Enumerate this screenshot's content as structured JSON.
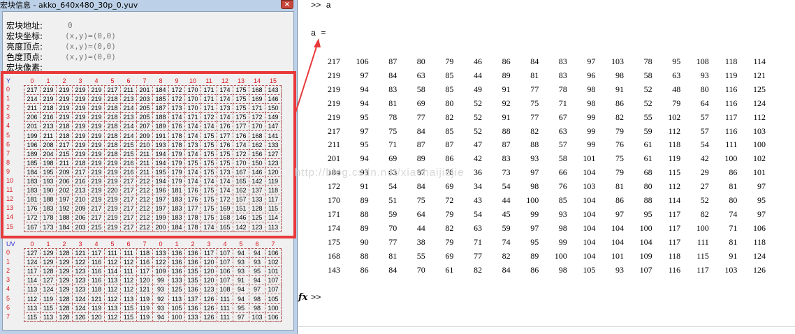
{
  "window": {
    "title": "宏块信息 - akko_640x480_30p_0.yuv",
    "close_label": "×"
  },
  "info": {
    "address_label": "宏块地址:",
    "address_value": "0",
    "coord_label": "宏块坐标:",
    "coord_value": "(x,y)=(0,0)",
    "luma_label": "亮度顶点:",
    "luma_value": "(x,y)=(0,0)",
    "chroma_label": "色度顶点:",
    "chroma_value": "(x,y)=(0,0)",
    "pixels_label": "宏块像素:"
  },
  "y_grid": {
    "corner": "Y",
    "columns": [
      "0",
      "1",
      "2",
      "3",
      "4",
      "5",
      "6",
      "7",
      "8",
      "9",
      "10",
      "11",
      "12",
      "13",
      "14",
      "15"
    ],
    "rows": [
      "0",
      "1",
      "2",
      "3",
      "4",
      "5",
      "6",
      "7",
      "8",
      "9",
      "10",
      "11",
      "12",
      "13",
      "14",
      "15"
    ],
    "values": [
      [
        217,
        219,
        219,
        219,
        219,
        217,
        211,
        201,
        184,
        172,
        170,
        171,
        174,
        175,
        168,
        143
      ],
      [
        214,
        219,
        219,
        219,
        219,
        218,
        213,
        203,
        185,
        172,
        170,
        171,
        174,
        175,
        169,
        146
      ],
      [
        211,
        218,
        219,
        219,
        219,
        218,
        214,
        205,
        187,
        173,
        170,
        171,
        173,
        175,
        171,
        150
      ],
      [
        206,
        216,
        219,
        219,
        219,
        218,
        213,
        205,
        188,
        174,
        171,
        172,
        174,
        175,
        172,
        149
      ],
      [
        201,
        213,
        218,
        219,
        219,
        218,
        214,
        207,
        189,
        176,
        174,
        174,
        176,
        177,
        170,
        147
      ],
      [
        199,
        211,
        218,
        219,
        219,
        218,
        214,
        209,
        191,
        178,
        174,
        175,
        177,
        176,
        168,
        141
      ],
      [
        196,
        208,
        217,
        219,
        219,
        218,
        215,
        210,
        193,
        178,
        173,
        175,
        176,
        174,
        162,
        133
      ],
      [
        189,
        204,
        215,
        219,
        219,
        218,
        215,
        211,
        194,
        179,
        174,
        175,
        175,
        172,
        156,
        127
      ],
      [
        185,
        198,
        211,
        218,
        219,
        219,
        216,
        211,
        194,
        179,
        175,
        175,
        175,
        170,
        150,
        123
      ],
      [
        184,
        195,
        209,
        217,
        219,
        219,
        216,
        211,
        195,
        179,
        174,
        175,
        173,
        167,
        146,
        120
      ],
      [
        183,
        193,
        206,
        216,
        219,
        219,
        217,
        212,
        194,
        179,
        174,
        174,
        174,
        165,
        142,
        119
      ],
      [
        183,
        190,
        202,
        213,
        219,
        220,
        217,
        212,
        196,
        181,
        176,
        175,
        174,
        162,
        137,
        118
      ],
      [
        181,
        188,
        197,
        210,
        219,
        219,
        217,
        212,
        197,
        183,
        176,
        175,
        172,
        157,
        133,
        117
      ],
      [
        176,
        183,
        192,
        209,
        217,
        219,
        217,
        212,
        197,
        183,
        177,
        175,
        169,
        151,
        128,
        115
      ],
      [
        172,
        178,
        188,
        206,
        217,
        219,
        217,
        212,
        199,
        183,
        178,
        175,
        168,
        146,
        125,
        114
      ],
      [
        167,
        173,
        184,
        203,
        215,
        219,
        217,
        212,
        200,
        184,
        178,
        174,
        165,
        142,
        123,
        113
      ]
    ]
  },
  "uv_grid": {
    "corner": "UV",
    "columns": [
      "0",
      "1",
      "2",
      "3",
      "4",
      "5",
      "6",
      "7",
      "0",
      "1",
      "2",
      "3",
      "4",
      "5",
      "6",
      "7"
    ],
    "rows": [
      "0",
      "1",
      "2",
      "3",
      "4",
      "5",
      "6",
      "7"
    ],
    "values": [
      [
        127,
        129,
        128,
        121,
        117,
        111,
        111,
        118,
        133,
        136,
        136,
        117,
        107,
        94,
        94,
        106
      ],
      [
        124,
        129,
        129,
        122,
        116,
        112,
        112,
        116,
        122,
        136,
        136,
        120,
        107,
        93,
        93,
        102
      ],
      [
        117,
        128,
        129,
        123,
        116,
        114,
        111,
        117,
        109,
        136,
        135,
        120,
        106,
        93,
        95,
        101
      ],
      [
        114,
        127,
        129,
        123,
        116,
        113,
        112,
        120,
        99,
        133,
        135,
        120,
        107,
        91,
        94,
        107
      ],
      [
        113,
        124,
        129,
        123,
        118,
        112,
        112,
        121,
        93,
        125,
        136,
        123,
        108,
        94,
        97,
        107
      ],
      [
        112,
        119,
        128,
        124,
        121,
        112,
        113,
        119,
        92,
        113,
        137,
        126,
        111,
        94,
        98,
        105
      ],
      [
        113,
        115,
        128,
        124,
        119,
        113,
        115,
        119,
        93,
        105,
        136,
        126,
        111,
        95,
        98,
        100
      ],
      [
        115,
        113,
        128,
        126,
        120,
        112,
        115,
        119,
        94,
        100,
        133,
        126,
        111,
        97,
        103,
        106
      ]
    ]
  },
  "console": {
    "prompt_top": ">> a",
    "var_line": "a =",
    "prompt_bottom": ">>",
    "fx_label": "fx",
    "watermark": "http://blog.csdn.net/xiaohaijiejie",
    "matrix": [
      [
        217,
        106,
        87,
        80,
        79,
        46,
        86,
        84,
        83,
        97,
        103,
        78,
        95,
        108,
        118,
        114
      ],
      [
        219,
        97,
        84,
        63,
        85,
        44,
        89,
        81,
        83,
        96,
        98,
        58,
        63,
        93,
        119,
        121
      ],
      [
        219,
        94,
        83,
        58,
        85,
        49,
        91,
        77,
        78,
        98,
        91,
        52,
        48,
        80,
        116,
        125
      ],
      [
        219,
        94,
        81,
        69,
        80,
        52,
        92,
        75,
        71,
        98,
        86,
        52,
        79,
        64,
        116,
        124
      ],
      [
        219,
        95,
        78,
        77,
        82,
        52,
        91,
        77,
        67,
        99,
        82,
        55,
        102,
        57,
        117,
        112
      ],
      [
        217,
        97,
        75,
        84,
        85,
        52,
        88,
        82,
        63,
        99,
        79,
        59,
        112,
        57,
        116,
        103
      ],
      [
        211,
        95,
        71,
        87,
        87,
        47,
        87,
        88,
        57,
        99,
        76,
        61,
        118,
        54,
        111,
        100
      ],
      [
        201,
        94,
        69,
        89,
        86,
        42,
        83,
        93,
        58,
        101,
        75,
        61,
        119,
        42,
        100,
        102
      ],
      [
        184,
        93,
        63,
        87,
        78,
        36,
        73,
        97,
        66,
        104,
        79,
        68,
        115,
        29,
        86,
        101
      ],
      [
        172,
        91,
        54,
        84,
        69,
        34,
        54,
        98,
        76,
        103,
        81,
        80,
        112,
        27,
        81,
        97
      ],
      [
        170,
        89,
        51,
        75,
        72,
        43,
        44,
        100,
        85,
        104,
        86,
        88,
        114,
        52,
        80,
        95
      ],
      [
        171,
        88,
        59,
        64,
        79,
        54,
        45,
        99,
        93,
        104,
        97,
        95,
        117,
        82,
        74,
        97
      ],
      [
        174,
        89,
        70,
        44,
        82,
        63,
        59,
        97,
        98,
        104,
        104,
        100,
        117,
        100,
        71,
        106
      ],
      [
        175,
        90,
        77,
        38,
        79,
        71,
        74,
        95,
        99,
        104,
        104,
        104,
        117,
        111,
        81,
        118
      ],
      [
        168,
        88,
        81,
        55,
        69,
        77,
        82,
        89,
        100,
        104,
        101,
        109,
        118,
        115,
        91,
        124
      ],
      [
        143,
        86,
        84,
        70,
        61,
        82,
        84,
        86,
        98,
        105,
        93,
        107,
        116,
        117,
        103,
        126
      ]
    ]
  }
}
